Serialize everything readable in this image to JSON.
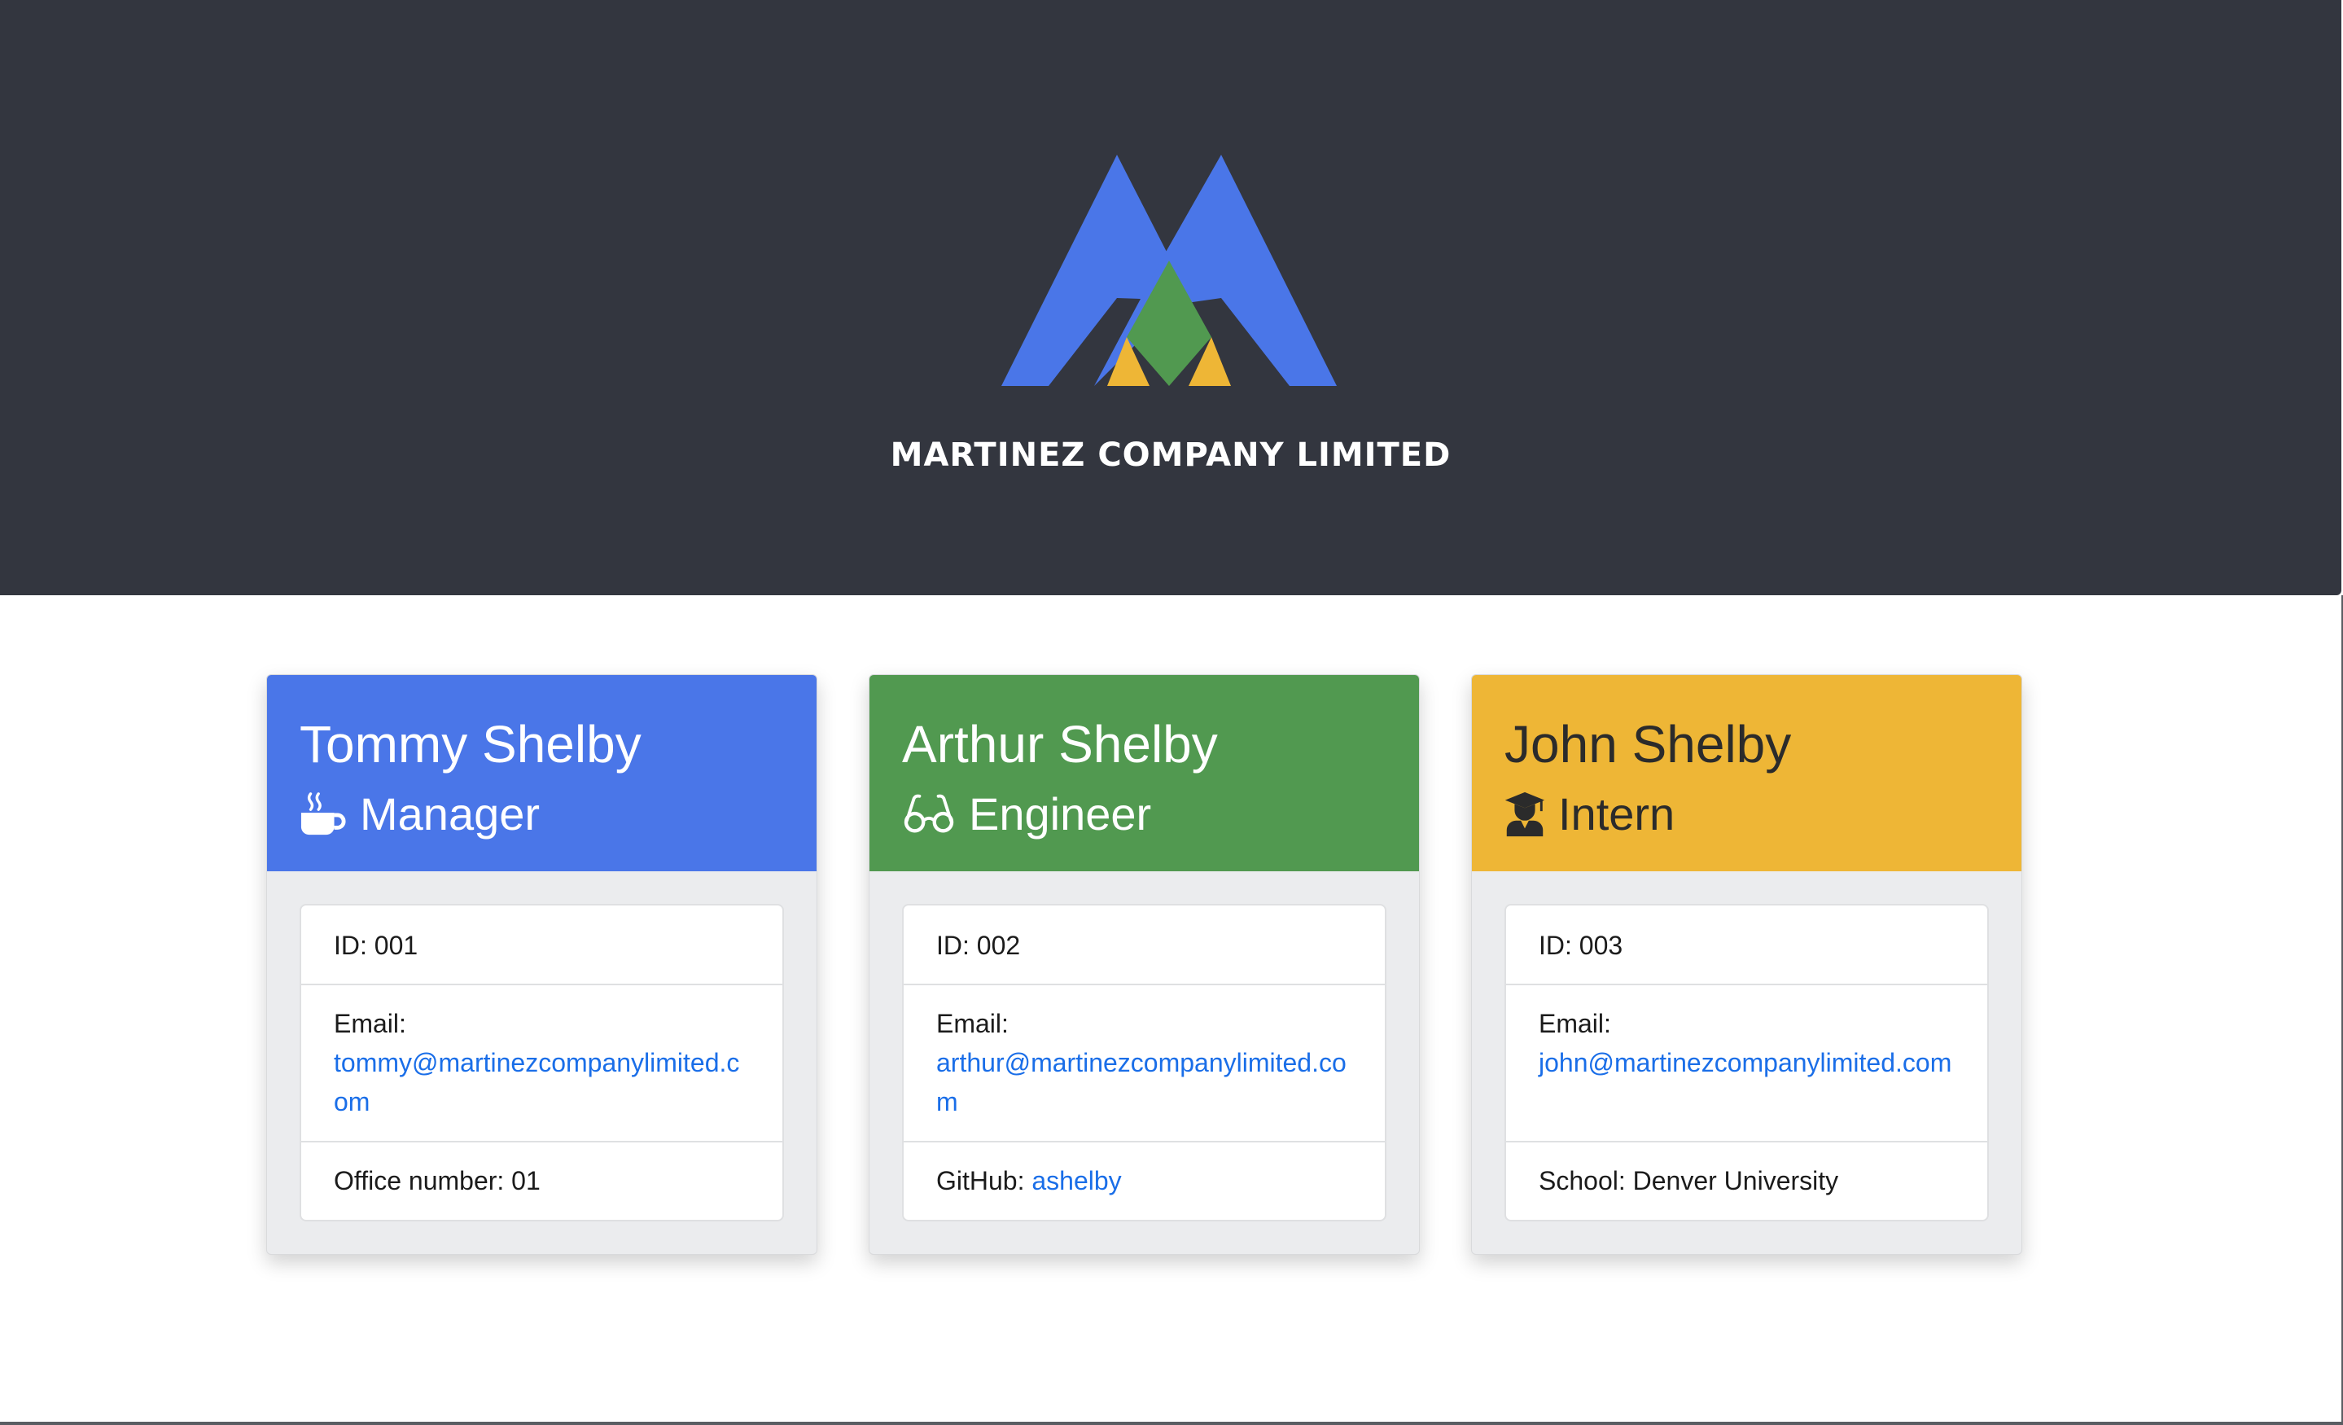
{
  "brand": {
    "company_name": "MARTINEZ COMPANY LIMITED",
    "logo_icon": "mountain-m-logo-icon",
    "colors": {
      "header_bg": "#33363f",
      "blue": "#4a76e8",
      "green": "#519950",
      "yellow": "#eeb636",
      "link": "#1a6ee8"
    }
  },
  "employees": [
    {
      "name": "Tommy Shelby",
      "role": "Manager",
      "role_icon": "coffee-mug-icon",
      "color": "#4a76e8",
      "id_text": "ID: 001",
      "email_label": "Email:",
      "email": "tommy@martinezcompanylimited.com",
      "extra_label": "Office number: 01",
      "extra_link": ""
    },
    {
      "name": "Arthur Shelby",
      "role": "Engineer",
      "role_icon": "glasses-icon",
      "color": "#519950",
      "id_text": "ID: 002",
      "email_label": "Email:",
      "email": "arthur@martinezcompanylimited.com",
      "extra_label": "GitHub: ",
      "extra_link": "ashelby"
    },
    {
      "name": "John Shelby",
      "role": "Intern",
      "role_icon": "graduate-icon",
      "color": "#eeb636",
      "id_text": "ID: 003",
      "email_label": "Email:",
      "email": "john@martinezcompanylimited.com",
      "extra_label": "School: Denver University",
      "extra_link": ""
    }
  ]
}
